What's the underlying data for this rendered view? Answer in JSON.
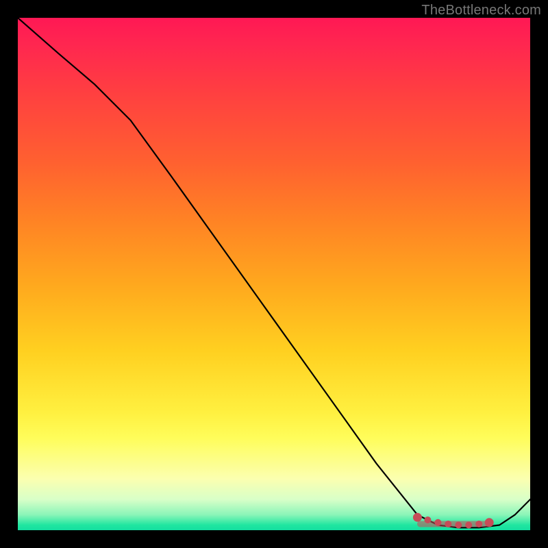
{
  "watermark": "TheBottleneck.com",
  "colors": {
    "curve": "#000000",
    "marker": "#c64c58",
    "background_black": "#000000"
  },
  "chart_data": {
    "type": "line",
    "title": "",
    "xlabel": "",
    "ylabel": "",
    "xlim": [
      0,
      100
    ],
    "ylim": [
      0,
      100
    ],
    "series": [
      {
        "name": "curve",
        "x": [
          0,
          8,
          15,
          22,
          30,
          40,
          50,
          60,
          70,
          78,
          82,
          86,
          90,
          94,
          97,
          100
        ],
        "values": [
          100,
          93,
          87,
          80,
          69,
          55,
          41,
          27,
          13,
          3,
          1,
          0.5,
          0.5,
          1,
          3,
          6
        ]
      }
    ],
    "markers": {
      "name": "highlighted-range",
      "x": [
        78,
        80,
        82,
        84,
        86,
        88,
        90,
        92
      ],
      "values": [
        2.5,
        2.0,
        1.5,
        1.2,
        1.0,
        1.0,
        1.2,
        1.5
      ]
    }
  }
}
